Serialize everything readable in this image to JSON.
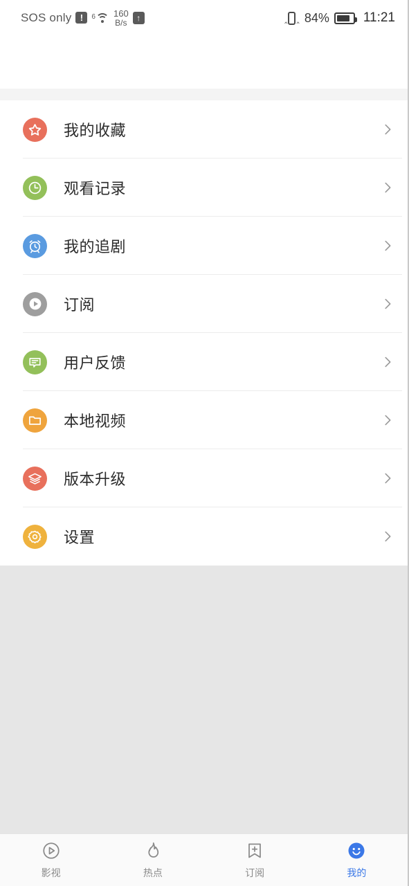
{
  "statusbar": {
    "carrier": "SOS only",
    "alert_icon": "!",
    "wifi_generation": "6",
    "wifi_icon": "wifi-icon",
    "netspeed_value": "160",
    "netspeed_unit": "B/s",
    "upload_icon": "↑",
    "vibrate_icon": "vibrate-icon",
    "battery_percent": "84%",
    "battery_level": 84,
    "battery_icon": "battery-icon",
    "time": "11:21"
  },
  "list": {
    "items": [
      {
        "label": "我的收藏",
        "icon": "star-icon",
        "color": "#e8705c"
      },
      {
        "label": "观看记录",
        "icon": "clock-icon",
        "color": "#93c05a"
      },
      {
        "label": "我的追剧",
        "icon": "alarm-icon",
        "color": "#5a9be0"
      },
      {
        "label": "订阅",
        "icon": "play-icon",
        "color": "#9e9e9e"
      },
      {
        "label": "用户反馈",
        "icon": "chat-icon",
        "color": "#93c05a"
      },
      {
        "label": "本地视频",
        "icon": "folder-icon",
        "color": "#efa43d"
      },
      {
        "label": "版本升级",
        "icon": "layers-icon",
        "color": "#e8705c"
      },
      {
        "label": "设置",
        "icon": "gear-icon",
        "color": "#efb23d"
      }
    ],
    "chevron_icon": "chevron-right-icon"
  },
  "tabbar": {
    "active_color": "#3b78e7",
    "inactive_color": "#8a8a8a",
    "tabs": [
      {
        "label": "影视",
        "icon": "play-circle-icon",
        "active": false
      },
      {
        "label": "热点",
        "icon": "flame-icon",
        "active": false
      },
      {
        "label": "订阅",
        "icon": "bookmark-plus-icon",
        "active": false
      },
      {
        "label": "我的",
        "icon": "smiley-face-icon",
        "active": true
      }
    ]
  }
}
